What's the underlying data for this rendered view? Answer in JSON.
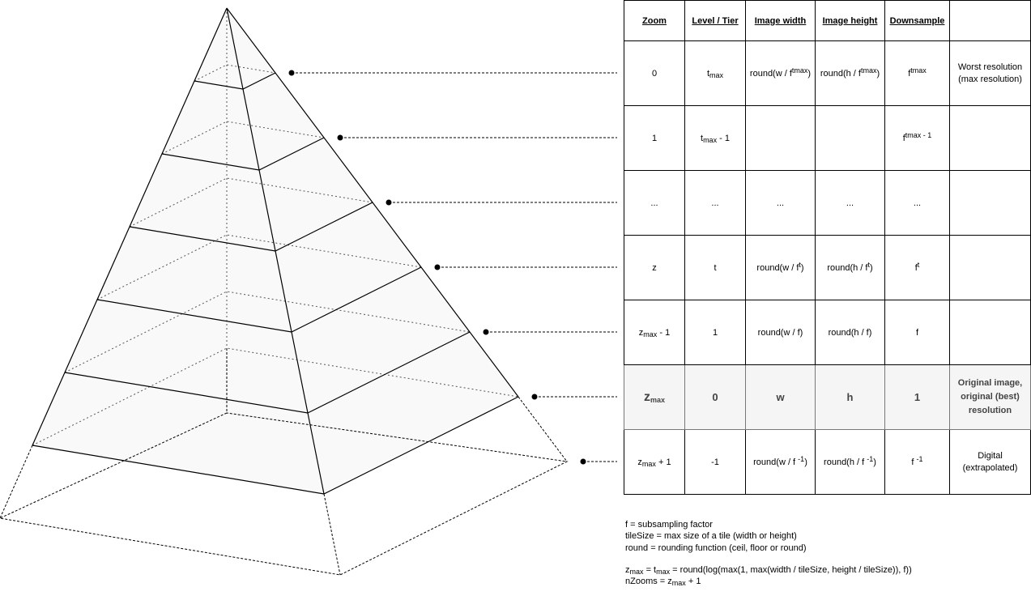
{
  "table": {
    "headers": [
      "Zoom",
      "Level / Tier",
      "Image width",
      "Image height",
      "Downsample",
      ""
    ],
    "rows": [
      {
        "zoom": {
          "base": "0",
          "sub": "",
          "after": ""
        },
        "level": {
          "base": "t",
          "sub": "max",
          "after": ""
        },
        "width": {
          "pre": "round(w / f",
          "sup": "tmax",
          "post": ")"
        },
        "height": {
          "pre": "round(h / f",
          "sup": "tmax",
          "post": ")"
        },
        "downsample": {
          "pre": "f",
          "sup": "tmax",
          "post": ""
        },
        "desc": "Worst resolution (max resolution)",
        "highlight": false
      },
      {
        "zoom": {
          "base": "1",
          "sub": "",
          "after": ""
        },
        "level": {
          "base": "t",
          "sub": "max",
          "after": " - 1"
        },
        "width": {
          "pre": "",
          "sup": "",
          "post": ""
        },
        "height": {
          "pre": "",
          "sup": "",
          "post": ""
        },
        "downsample": {
          "pre": "f",
          "sup": "tmax - 1",
          "post": ""
        },
        "desc": "",
        "highlight": false
      },
      {
        "zoom": {
          "base": "...",
          "sub": "",
          "after": ""
        },
        "level": {
          "base": "...",
          "sub": "",
          "after": ""
        },
        "width": {
          "pre": "...",
          "sup": "",
          "post": ""
        },
        "height": {
          "pre": "...",
          "sup": "",
          "post": ""
        },
        "downsample": {
          "pre": "...",
          "sup": "",
          "post": ""
        },
        "desc": "",
        "highlight": false
      },
      {
        "zoom": {
          "base": "z",
          "sub": "",
          "after": ""
        },
        "level": {
          "base": "t",
          "sub": "",
          "after": ""
        },
        "width": {
          "pre": "round(w / f",
          "sup": "t",
          "post": ")"
        },
        "height": {
          "pre": "round(h / f",
          "sup": "t",
          "post": ")"
        },
        "downsample": {
          "pre": "f",
          "sup": "t",
          "post": ""
        },
        "desc": "",
        "highlight": false
      },
      {
        "zoom": {
          "base": "z",
          "sub": "max",
          "after": " - 1"
        },
        "level": {
          "base": "1",
          "sub": "",
          "after": ""
        },
        "width": {
          "pre": "round(w / f)",
          "sup": "",
          "post": ""
        },
        "height": {
          "pre": "round(h / f)",
          "sup": "",
          "post": ""
        },
        "downsample": {
          "pre": "f",
          "sup": "",
          "post": ""
        },
        "desc": "",
        "highlight": false
      },
      {
        "zoom": {
          "base": "z",
          "sub": "max",
          "after": ""
        },
        "level": {
          "base": "0",
          "sub": "",
          "after": ""
        },
        "width": {
          "pre": "w",
          "sup": "",
          "post": ""
        },
        "height": {
          "pre": "h",
          "sup": "",
          "post": ""
        },
        "downsample": {
          "pre": "1",
          "sup": "",
          "post": ""
        },
        "desc": "Original image, original (best) resolution",
        "highlight": true
      },
      {
        "zoom": {
          "base": "z",
          "sub": "max",
          "after": " + 1"
        },
        "level": {
          "base": "-1",
          "sub": "",
          "after": ""
        },
        "width": {
          "pre": "round(w / f ",
          "sup": "-1",
          "post": ")"
        },
        "height": {
          "pre": "round(h / f ",
          "sup": "-1",
          "post": ")"
        },
        "downsample": {
          "pre": "f ",
          "sup": "-1",
          "post": ""
        },
        "desc": "Digital (extrapolated)",
        "highlight": false
      }
    ]
  },
  "notes": {
    "line1": "f = subsampling factor",
    "line2": "tileSize = max size of a tile (width or height)",
    "line3": "round = rounding function (ceil, floor or round)",
    "formula1": {
      "z": "z",
      "z_sub": "max",
      "eq1": " = t",
      "t_sub": "max",
      "rest": " = round(log(max(1, max(width / tileSize, height / tileSize)), f))"
    },
    "formula2": {
      "pre": "nZooms = z",
      "sub": "max",
      "post": " + 1"
    }
  },
  "pyramid": {
    "levels": 7,
    "solid_levels": 6,
    "fill_color": "#f9f9f9",
    "stroke_color": "#000000"
  }
}
